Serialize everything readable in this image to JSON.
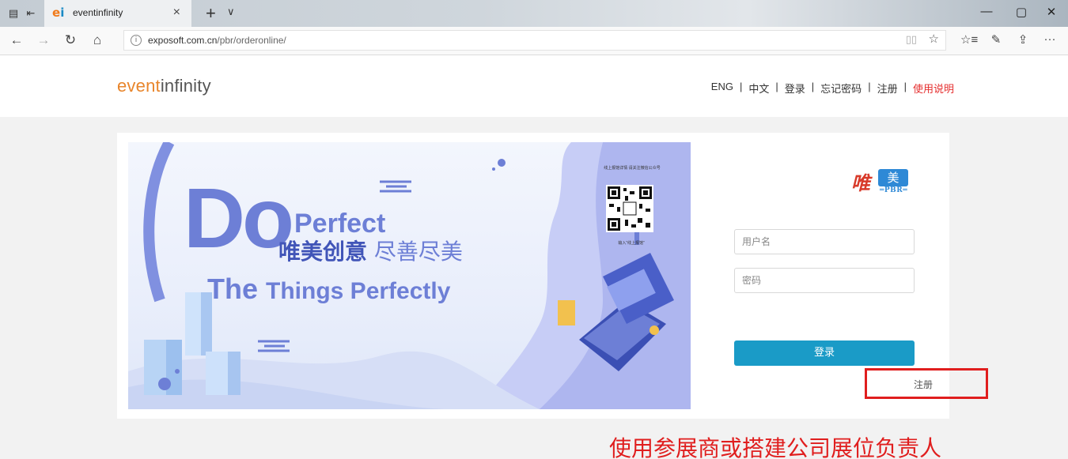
{
  "browser": {
    "tab": {
      "title": "eventinfinity"
    },
    "new_tab": "+",
    "tab_list": "∨",
    "window_controls": {
      "minimize": "—",
      "maximize": "▢",
      "close": "✕"
    },
    "nav": {
      "back": "←",
      "forward": "→",
      "refresh": "↻",
      "home": "⌂"
    },
    "url": {
      "host": "exposoft.com.cn",
      "path": "/pbr/orderonline/"
    },
    "toolbar": {
      "reading": "▯▯",
      "favorite": "☆",
      "favorites_hub": "☆≡",
      "notes": "✎",
      "share": "⇪",
      "more": "···"
    }
  },
  "site": {
    "logo": {
      "part1": "event",
      "part2": "infinity"
    },
    "nav": [
      {
        "label": "ENG"
      },
      {
        "label": "中文"
      },
      {
        "label": "登录"
      },
      {
        "label": "忘记密码"
      },
      {
        "label": "注册"
      },
      {
        "label": "使用说明"
      }
    ],
    "separator": "|"
  },
  "banner": {
    "big": "Do",
    "line1": "Perfect",
    "cn_bold": "唯美创意",
    "cn_light": "尽善尽美",
    "line3_the": "The",
    "line3_rest": "Things Perfectly",
    "qr_caption_top": "线上报馆详情 请关注微信公众号",
    "qr_caption_bottom": "输入“线上报馆”"
  },
  "brand": {
    "wei": "唯",
    "mei": "美",
    "pbr": "═PBR═"
  },
  "login": {
    "username_placeholder": "用户名",
    "password_placeholder": "密码",
    "submit_label": "登录",
    "register_label": "注册"
  },
  "notice": "使用参展商或搭建公司展位负责人",
  "colors": {
    "accent": "#1a9bc7",
    "highlight": "#e01e1e",
    "logo_orange": "#e8852b",
    "banner_blue": "#6d7fd6"
  }
}
